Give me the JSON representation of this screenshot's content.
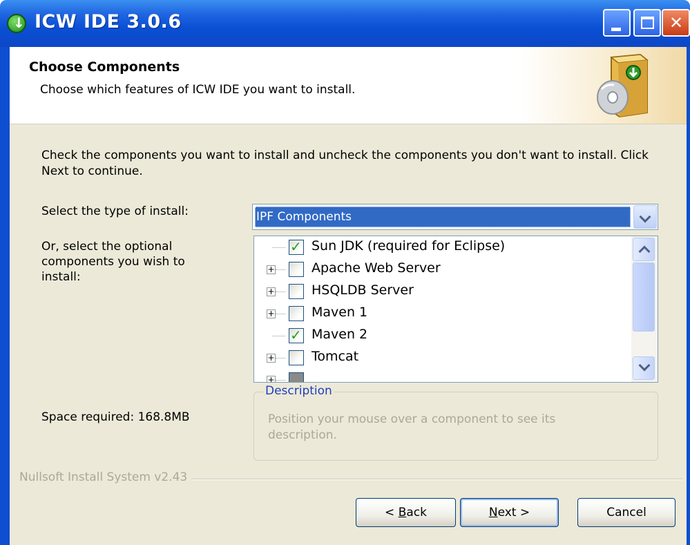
{
  "window": {
    "title": "ICW IDE 3.0.6",
    "controls": [
      "minimize",
      "maximize",
      "close"
    ]
  },
  "header": {
    "title": "Choose Components",
    "subtitle": "Choose which features of ICW IDE you want to install."
  },
  "body": {
    "intro": "Check the components you want to install and uncheck the components you don't want to install. Click Next to continue.",
    "install_type_label": "Select the type of install:",
    "install_type_value": "IPF Components",
    "optional_label": "Or, select the optional components you wish to install:",
    "components": [
      {
        "label": "Sun JDK (required for Eclipse)",
        "checked": true,
        "expandable": false
      },
      {
        "label": "Apache Web Server",
        "checked": false,
        "expandable": true
      },
      {
        "label": "HSQLDB Server",
        "checked": false,
        "expandable": true
      },
      {
        "label": "Maven 1",
        "checked": false,
        "expandable": true
      },
      {
        "label": "Maven 2",
        "checked": true,
        "expandable": false
      },
      {
        "label": "Tomcat",
        "checked": false,
        "expandable": true
      }
    ],
    "description_title": "Description",
    "description_text": "Position your mouse over a component to see its description.",
    "space_required": "Space required: 168.8MB"
  },
  "footer": {
    "brand": "Nullsoft Install System v2.43",
    "back_prefix": "< ",
    "back_mnemonic": "B",
    "back_rest": "ack",
    "next_mnemonic": "N",
    "next_rest": "ext >",
    "cancel": "Cancel"
  }
}
